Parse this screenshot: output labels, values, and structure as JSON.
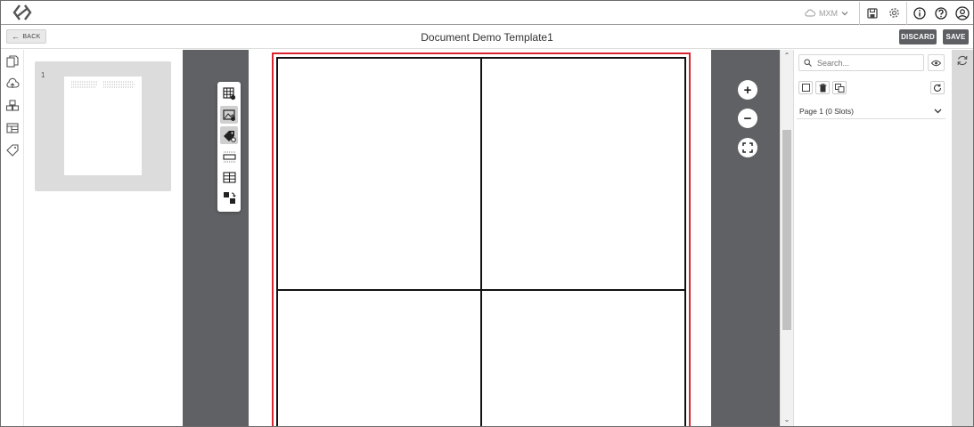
{
  "topbar": {
    "org_name": "MXM",
    "icons": [
      "app-logo-icon",
      "cloud-icon",
      "chevron-down-icon",
      "save-disk-icon",
      "gear-icon",
      "info-icon",
      "help-icon",
      "user-icon"
    ]
  },
  "header": {
    "back_label": "BACK",
    "title": "Document Demo Template1",
    "discard_label": "DISCARD",
    "save_label": "SAVE"
  },
  "left_rail": {
    "icons": [
      "pages-icon",
      "cloud-upload-icon",
      "components-icon",
      "layout-icon",
      "tag-icon"
    ]
  },
  "pages_panel": {
    "pages": [
      {
        "number": "1"
      }
    ]
  },
  "palette": {
    "tools": [
      "grid-slot-icon",
      "image-slot-icon",
      "tag-slot-icon",
      "row-layout-icon",
      "table-icon",
      "swap-icon"
    ],
    "active_tools": [
      "image-slot-icon",
      "tag-slot-icon"
    ]
  },
  "zoom": {
    "in": "+",
    "out": "−",
    "fit": "fit-screen-icon"
  },
  "right_panel": {
    "search_placeholder": "Search...",
    "page_section_label": "Page 1 (0 Slots)"
  },
  "colors": {
    "selection": "#d9252e",
    "canvas_bg": "#5f6164",
    "button_dark": "#5d5f63"
  }
}
